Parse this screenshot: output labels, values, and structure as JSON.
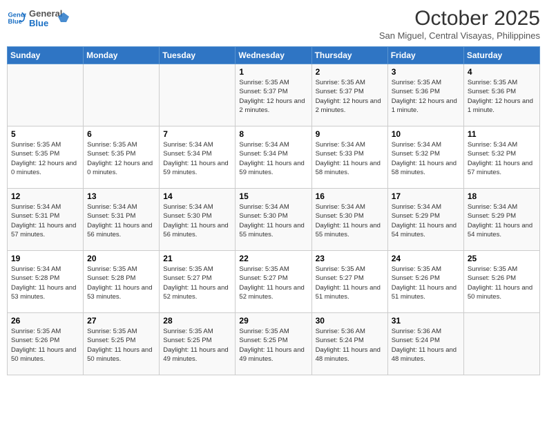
{
  "header": {
    "logo_line1": "General",
    "logo_line2": "Blue",
    "month": "October 2025",
    "location": "San Miguel, Central Visayas, Philippines"
  },
  "days_of_week": [
    "Sunday",
    "Monday",
    "Tuesday",
    "Wednesday",
    "Thursday",
    "Friday",
    "Saturday"
  ],
  "weeks": [
    [
      {
        "day": "",
        "info": ""
      },
      {
        "day": "",
        "info": ""
      },
      {
        "day": "",
        "info": ""
      },
      {
        "day": "1",
        "info": "Sunrise: 5:35 AM\nSunset: 5:37 PM\nDaylight: 12 hours and 2 minutes."
      },
      {
        "day": "2",
        "info": "Sunrise: 5:35 AM\nSunset: 5:37 PM\nDaylight: 12 hours and 2 minutes."
      },
      {
        "day": "3",
        "info": "Sunrise: 5:35 AM\nSunset: 5:36 PM\nDaylight: 12 hours and 1 minute."
      },
      {
        "day": "4",
        "info": "Sunrise: 5:35 AM\nSunset: 5:36 PM\nDaylight: 12 hours and 1 minute."
      }
    ],
    [
      {
        "day": "5",
        "info": "Sunrise: 5:35 AM\nSunset: 5:35 PM\nDaylight: 12 hours and 0 minutes."
      },
      {
        "day": "6",
        "info": "Sunrise: 5:35 AM\nSunset: 5:35 PM\nDaylight: 12 hours and 0 minutes."
      },
      {
        "day": "7",
        "info": "Sunrise: 5:34 AM\nSunset: 5:34 PM\nDaylight: 11 hours and 59 minutes."
      },
      {
        "day": "8",
        "info": "Sunrise: 5:34 AM\nSunset: 5:34 PM\nDaylight: 11 hours and 59 minutes."
      },
      {
        "day": "9",
        "info": "Sunrise: 5:34 AM\nSunset: 5:33 PM\nDaylight: 11 hours and 58 minutes."
      },
      {
        "day": "10",
        "info": "Sunrise: 5:34 AM\nSunset: 5:32 PM\nDaylight: 11 hours and 58 minutes."
      },
      {
        "day": "11",
        "info": "Sunrise: 5:34 AM\nSunset: 5:32 PM\nDaylight: 11 hours and 57 minutes."
      }
    ],
    [
      {
        "day": "12",
        "info": "Sunrise: 5:34 AM\nSunset: 5:31 PM\nDaylight: 11 hours and 57 minutes."
      },
      {
        "day": "13",
        "info": "Sunrise: 5:34 AM\nSunset: 5:31 PM\nDaylight: 11 hours and 56 minutes."
      },
      {
        "day": "14",
        "info": "Sunrise: 5:34 AM\nSunset: 5:30 PM\nDaylight: 11 hours and 56 minutes."
      },
      {
        "day": "15",
        "info": "Sunrise: 5:34 AM\nSunset: 5:30 PM\nDaylight: 11 hours and 55 minutes."
      },
      {
        "day": "16",
        "info": "Sunrise: 5:34 AM\nSunset: 5:30 PM\nDaylight: 11 hours and 55 minutes."
      },
      {
        "day": "17",
        "info": "Sunrise: 5:34 AM\nSunset: 5:29 PM\nDaylight: 11 hours and 54 minutes."
      },
      {
        "day": "18",
        "info": "Sunrise: 5:34 AM\nSunset: 5:29 PM\nDaylight: 11 hours and 54 minutes."
      }
    ],
    [
      {
        "day": "19",
        "info": "Sunrise: 5:34 AM\nSunset: 5:28 PM\nDaylight: 11 hours and 53 minutes."
      },
      {
        "day": "20",
        "info": "Sunrise: 5:35 AM\nSunset: 5:28 PM\nDaylight: 11 hours and 53 minutes."
      },
      {
        "day": "21",
        "info": "Sunrise: 5:35 AM\nSunset: 5:27 PM\nDaylight: 11 hours and 52 minutes."
      },
      {
        "day": "22",
        "info": "Sunrise: 5:35 AM\nSunset: 5:27 PM\nDaylight: 11 hours and 52 minutes."
      },
      {
        "day": "23",
        "info": "Sunrise: 5:35 AM\nSunset: 5:27 PM\nDaylight: 11 hours and 51 minutes."
      },
      {
        "day": "24",
        "info": "Sunrise: 5:35 AM\nSunset: 5:26 PM\nDaylight: 11 hours and 51 minutes."
      },
      {
        "day": "25",
        "info": "Sunrise: 5:35 AM\nSunset: 5:26 PM\nDaylight: 11 hours and 50 minutes."
      }
    ],
    [
      {
        "day": "26",
        "info": "Sunrise: 5:35 AM\nSunset: 5:26 PM\nDaylight: 11 hours and 50 minutes."
      },
      {
        "day": "27",
        "info": "Sunrise: 5:35 AM\nSunset: 5:25 PM\nDaylight: 11 hours and 50 minutes."
      },
      {
        "day": "28",
        "info": "Sunrise: 5:35 AM\nSunset: 5:25 PM\nDaylight: 11 hours and 49 minutes."
      },
      {
        "day": "29",
        "info": "Sunrise: 5:35 AM\nSunset: 5:25 PM\nDaylight: 11 hours and 49 minutes."
      },
      {
        "day": "30",
        "info": "Sunrise: 5:36 AM\nSunset: 5:24 PM\nDaylight: 11 hours and 48 minutes."
      },
      {
        "day": "31",
        "info": "Sunrise: 5:36 AM\nSunset: 5:24 PM\nDaylight: 11 hours and 48 minutes."
      },
      {
        "day": "",
        "info": ""
      }
    ]
  ]
}
